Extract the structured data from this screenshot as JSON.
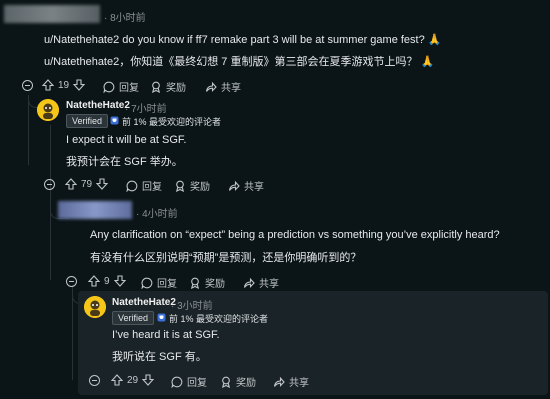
{
  "comment1": {
    "time": "· 8小时前",
    "lines": [
      "u/Natethehate2 do you know if ff7 remake part 3 will be at summer game fest? 🙏",
      "u/Natethehate2，你知道《最终幻想 7 重制版》第三部会在夏季游戏节上吗？ 🙏"
    ],
    "actions": {
      "votes": "19",
      "reply": "回复",
      "award": "奖励",
      "share": "共享"
    }
  },
  "comment2": {
    "username": "NatetheHate2",
    "time": "· 7小时前",
    "verified": "Verified",
    "badge": "前 1% 最受欢迎的评论者",
    "lines": [
      "I expect it will be at SGF.",
      "我预计会在 SGF 举办。"
    ],
    "actions": {
      "votes": "79",
      "reply": "回复",
      "award": "奖励",
      "share": "共享"
    }
  },
  "comment3": {
    "time": "· 4小时前",
    "lines": [
      "Any clarification on “expect” being a prediction vs something you’ve explicitly heard?",
      "有没有什么区别说明“预期”是预测，还是你明确听到的？"
    ],
    "actions": {
      "votes": "9",
      "reply": "回复",
      "award": "奖励",
      "share": "共享"
    }
  },
  "comment4": {
    "username": "NatetheHate2",
    "time": "· 3小时前",
    "verified": "Verified",
    "badge": "前 1% 最受欢迎的评论者",
    "lines": [
      "I’ve heard it is at SGF.",
      "我听说在 SGF 有。"
    ],
    "actions": {
      "votes": "29",
      "reply": "回复",
      "award": "奖励",
      "share": "共享"
    }
  },
  "icons": [
    "upvote-icon",
    "downvote-icon",
    "comment-icon",
    "award-icon",
    "share-icon",
    "collapse-icon",
    "trophy-icon"
  ],
  "colors": {
    "background": "#0b1416",
    "highlight": "#1a2327",
    "avatar": "#f5c518"
  }
}
